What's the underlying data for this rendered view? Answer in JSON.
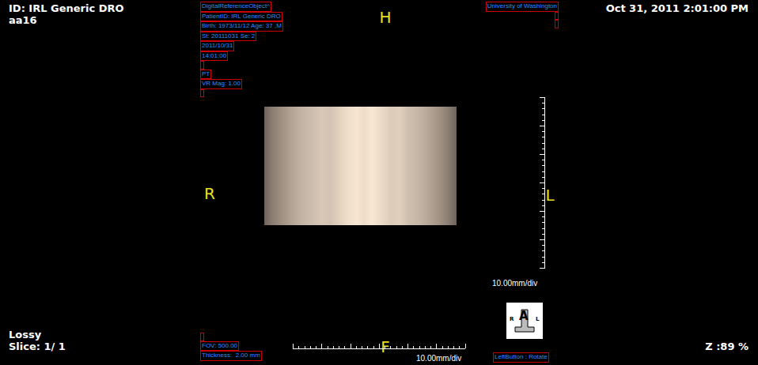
{
  "top_left": {
    "lines": [
      "ID: IRL Generic DRO",
      "aa16"
    ]
  },
  "top_right": {
    "datetime": "Oct 31, 2011 2:01:00 PM"
  },
  "bottom_left": {
    "lines": [
      "Lossy",
      "Slice: 1/ 1"
    ]
  },
  "bottom_right": {
    "zoom": "Z :89 %"
  },
  "overlay_left": {
    "lines": [
      "DigitalReferenceObject^",
      "PatientID: IRL Generic DRO",
      "Birth: 1973/11/12 Age: 37 ,M",
      "St: 20111031 Se: 2",
      "2011/10/31",
      "14:01:00",
      "",
      "PT",
      "VR Mag: 1.00",
      ""
    ]
  },
  "overlay_right": {
    "lines": [
      "University of Washington",
      "",
      ""
    ]
  },
  "overlay_bottom_left": {
    "lines": [
      "",
      "FOV: 500.00",
      "Thickness:  2.00 mm"
    ]
  },
  "overlay_bottom_right": {
    "lines": [
      "LeftButton : Rotate"
    ]
  },
  "orientation": {
    "top": "H",
    "left": "R",
    "right": "L",
    "bottom": "F"
  },
  "ruler_vertical": {
    "label": "10.00mm/div"
  },
  "ruler_horizontal": {
    "label": "10.00mm/div"
  },
  "orientation_cube": {
    "front": "A",
    "left": "R",
    "right": "L"
  }
}
